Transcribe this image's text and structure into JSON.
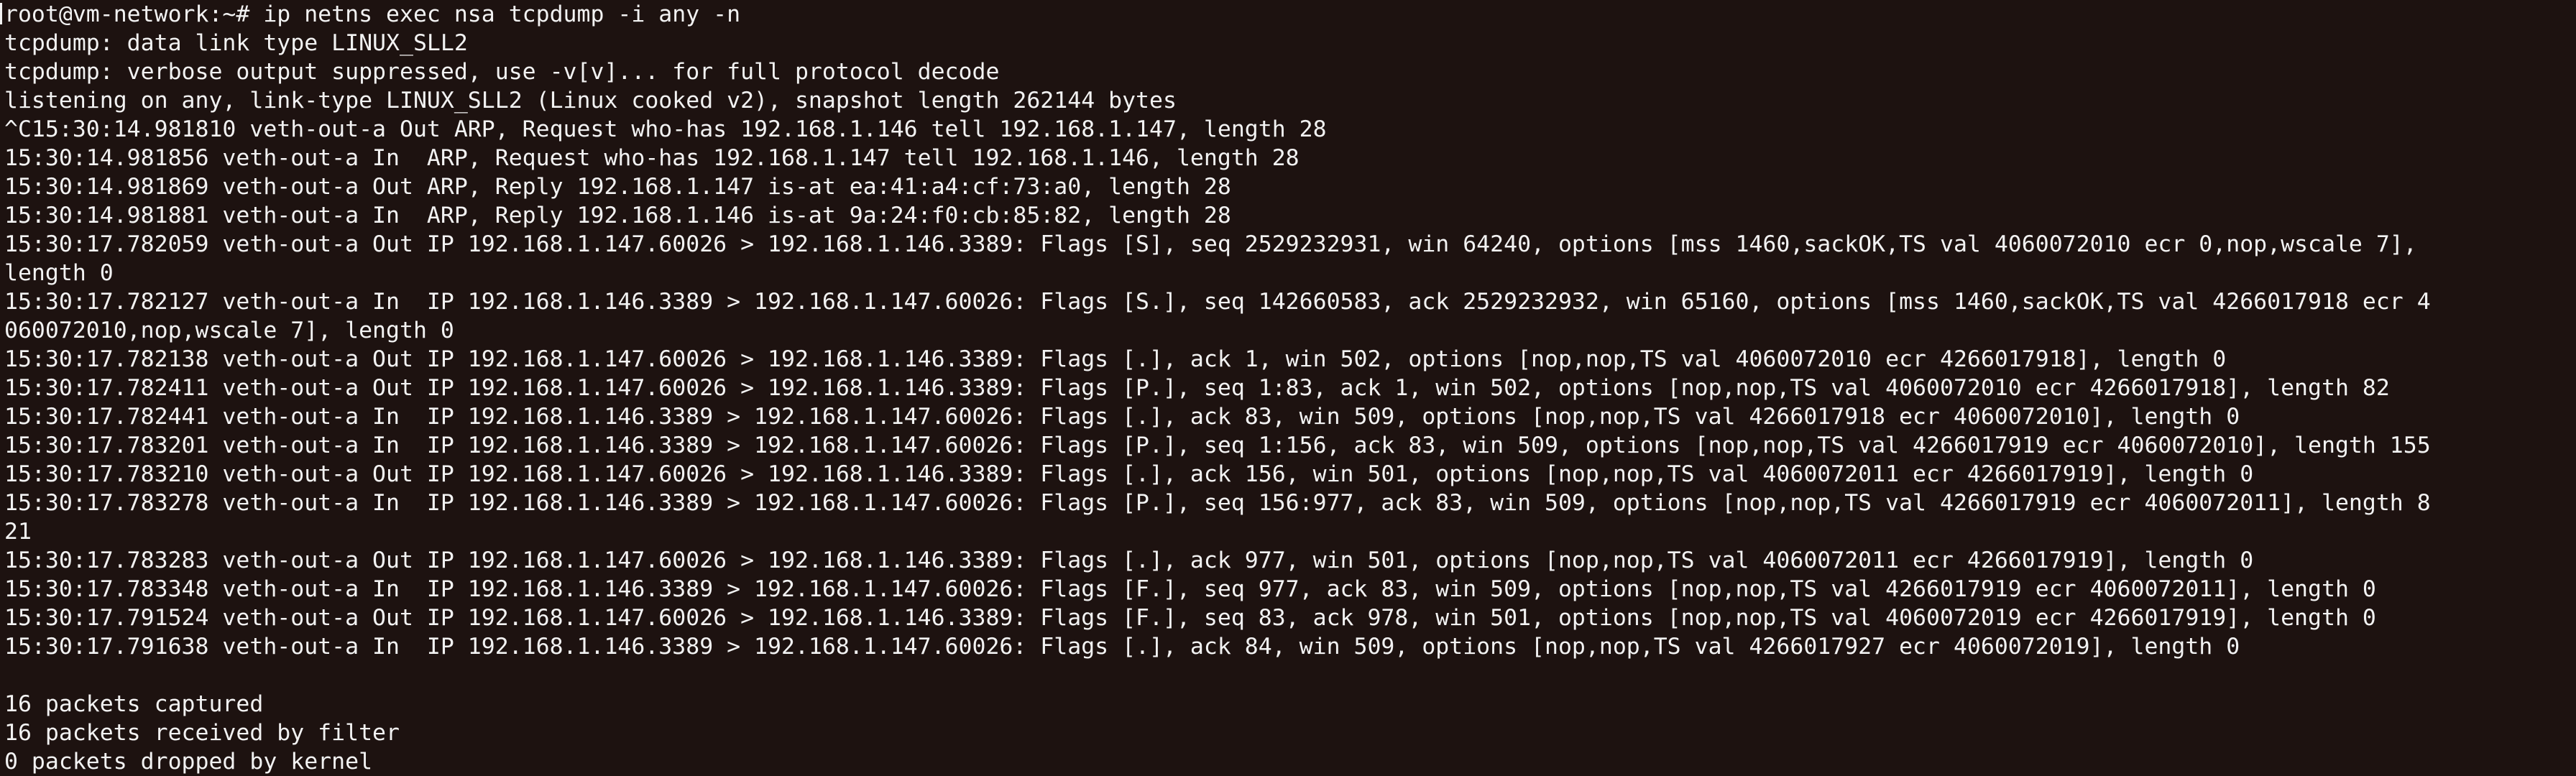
{
  "terminal": {
    "lines": [
      "root@vm-network:~# ip netns exec nsa tcpdump -i any -n",
      "tcpdump: data link type LINUX_SLL2",
      "tcpdump: verbose output suppressed, use -v[v]... for full protocol decode",
      "listening on any, link-type LINUX_SLL2 (Linux cooked v2), snapshot length 262144 bytes",
      "^C15:30:14.981810 veth-out-a Out ARP, Request who-has 192.168.1.146 tell 192.168.1.147, length 28",
      "15:30:14.981856 veth-out-a In  ARP, Request who-has 192.168.1.147 tell 192.168.1.146, length 28",
      "15:30:14.981869 veth-out-a Out ARP, Reply 192.168.1.147 is-at ea:41:a4:cf:73:a0, length 28",
      "15:30:14.981881 veth-out-a In  ARP, Reply 192.168.1.146 is-at 9a:24:f0:cb:85:82, length 28",
      "15:30:17.782059 veth-out-a Out IP 192.168.1.147.60026 > 192.168.1.146.3389: Flags [S], seq 2529232931, win 64240, options [mss 1460,sackOK,TS val 4060072010 ecr 0,nop,wscale 7],",
      "length 0",
      "15:30:17.782127 veth-out-a In  IP 192.168.1.146.3389 > 192.168.1.147.60026: Flags [S.], seq 142660583, ack 2529232932, win 65160, options [mss 1460,sackOK,TS val 4266017918 ecr 4",
      "060072010,nop,wscale 7], length 0",
      "15:30:17.782138 veth-out-a Out IP 192.168.1.147.60026 > 192.168.1.146.3389: Flags [.], ack 1, win 502, options [nop,nop,TS val 4060072010 ecr 4266017918], length 0",
      "15:30:17.782411 veth-out-a Out IP 192.168.1.147.60026 > 192.168.1.146.3389: Flags [P.], seq 1:83, ack 1, win 502, options [nop,nop,TS val 4060072010 ecr 4266017918], length 82",
      "15:30:17.782441 veth-out-a In  IP 192.168.1.146.3389 > 192.168.1.147.60026: Flags [.], ack 83, win 509, options [nop,nop,TS val 4266017918 ecr 4060072010], length 0",
      "15:30:17.783201 veth-out-a In  IP 192.168.1.146.3389 > 192.168.1.147.60026: Flags [P.], seq 1:156, ack 83, win 509, options [nop,nop,TS val 4266017919 ecr 4060072010], length 155",
      "15:30:17.783210 veth-out-a Out IP 192.168.1.147.60026 > 192.168.1.146.3389: Flags [.], ack 156, win 501, options [nop,nop,TS val 4060072011 ecr 4266017919], length 0",
      "15:30:17.783278 veth-out-a In  IP 192.168.1.146.3389 > 192.168.1.147.60026: Flags [P.], seq 156:977, ack 83, win 509, options [nop,nop,TS val 4266017919 ecr 4060072011], length 8",
      "21",
      "15:30:17.783283 veth-out-a Out IP 192.168.1.147.60026 > 192.168.1.146.3389: Flags [.], ack 977, win 501, options [nop,nop,TS val 4060072011 ecr 4266017919], length 0",
      "15:30:17.783348 veth-out-a In  IP 192.168.1.146.3389 > 192.168.1.147.60026: Flags [F.], seq 977, ack 83, win 509, options [nop,nop,TS val 4266017919 ecr 4060072011], length 0",
      "15:30:17.791524 veth-out-a Out IP 192.168.1.147.60026 > 192.168.1.146.3389: Flags [F.], seq 83, ack 978, win 501, options [nop,nop,TS val 4060072019 ecr 4266017919], length 0",
      "15:30:17.791638 veth-out-a In  IP 192.168.1.146.3389 > 192.168.1.147.60026: Flags [.], ack 84, win 509, options [nop,nop,TS val 4266017927 ecr 4060072019], length 0",
      "",
      "16 packets captured",
      "16 packets received by filter",
      "0 packets dropped by kernel"
    ]
  },
  "colors": {
    "background": "#1d1210",
    "foreground": "#f2f2f2"
  }
}
